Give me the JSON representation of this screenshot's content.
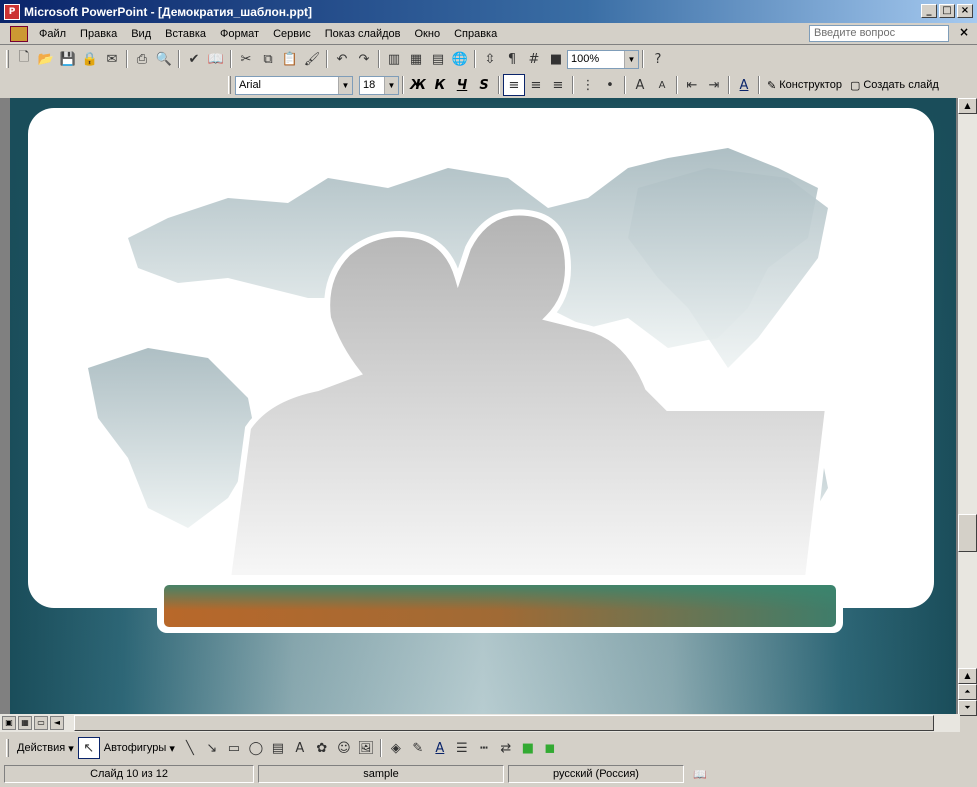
{
  "window": {
    "title": "Microsoft PowerPoint - [Демократия_шаблон.ppt]",
    "app_icon": "powerpoint-icon"
  },
  "menubar": {
    "items": [
      "Файл",
      "Правка",
      "Вид",
      "Вставка",
      "Формат",
      "Сервис",
      "Показ слайдов",
      "Окно",
      "Справка"
    ],
    "help_placeholder": "Введите вопрос"
  },
  "standard_toolbar": {
    "zoom": "100%",
    "icons": [
      "new-icon",
      "open-icon",
      "save-icon",
      "permission-icon",
      "email-icon",
      "print-icon",
      "print-preview-icon",
      "spelling-icon",
      "research-icon",
      "cut-icon",
      "copy-icon",
      "paste-icon",
      "format-painter-icon",
      "undo-icon",
      "redo-icon",
      "insert-chart-icon",
      "insert-table-icon",
      "tables-borders-icon",
      "hyperlink-icon",
      "expand-icon",
      "show-formatting-icon",
      "grid-icon",
      "color-grayscale-icon",
      "help-icon"
    ]
  },
  "formatting_toolbar": {
    "font": "Arial",
    "size": "18",
    "bold": "Ж",
    "italic": "К",
    "underline": "Ч",
    "shadow": "S",
    "designer_label": "Конструктор",
    "new_slide_label": "Создать слайд"
  },
  "drawing_toolbar": {
    "actions_label": "Действия",
    "autoshapes_label": "Автофигуры"
  },
  "statusbar": {
    "slide": "Слайд 10 из 12",
    "design": "sample",
    "language": "русский (Россия)"
  },
  "colors": {
    "slide_bg_dark": "#1a4d5a",
    "title_bar_left": "#b8682a",
    "title_bar_right": "#3f7d6a"
  }
}
